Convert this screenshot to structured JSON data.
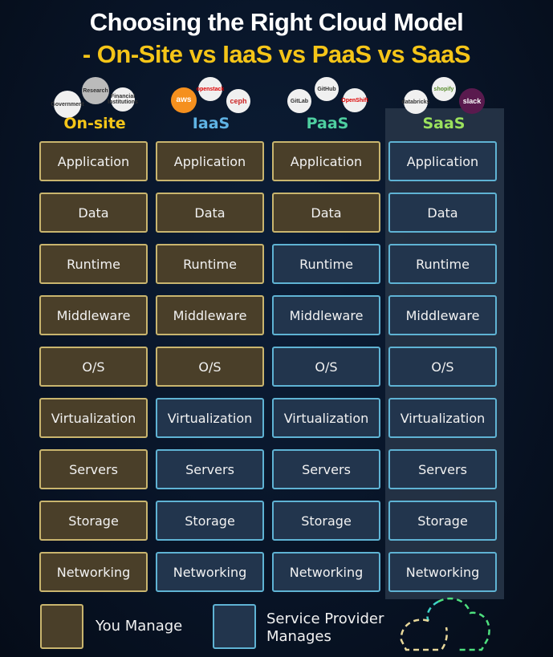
{
  "title": {
    "line1": "Choosing the Right Cloud Model",
    "line2": "- On-Site vs IaaS vs PaaS vs SaaS"
  },
  "columns": [
    {
      "label": "On-site",
      "color": "#f5c518",
      "logos": [
        "Government",
        "Research",
        "Financial Institutions"
      ]
    },
    {
      "label": "IaaS",
      "color": "#5fb3e4",
      "logos": [
        "aws",
        "openstack",
        "ceph"
      ]
    },
    {
      "label": "PaaS",
      "color": "#4ecfa0",
      "logos": [
        "GitLab",
        "GitHub",
        "OpenShift"
      ]
    },
    {
      "label": "SaaS",
      "color": "#9be15d",
      "logos": [
        "databricks",
        "shopify",
        "slack"
      ]
    }
  ],
  "layers": [
    "Application",
    "Data",
    "Runtime",
    "Middleware",
    "O/S",
    "Virtualization",
    "Servers",
    "Storage",
    "Networking"
  ],
  "managed_by": {
    "On-site": [
      "you",
      "you",
      "you",
      "you",
      "you",
      "you",
      "you",
      "you",
      "you"
    ],
    "IaaS": [
      "you",
      "you",
      "you",
      "you",
      "you",
      "provider",
      "provider",
      "provider",
      "provider"
    ],
    "PaaS": [
      "you",
      "you",
      "provider",
      "provider",
      "provider",
      "provider",
      "provider",
      "provider",
      "provider"
    ],
    "SaaS": [
      "provider",
      "provider",
      "provider",
      "provider",
      "provider",
      "provider",
      "provider",
      "provider",
      "provider"
    ]
  },
  "legend": {
    "you": "You Manage",
    "provider_line1": "Service Provider",
    "provider_line2": "Manages"
  },
  "colors": {
    "you_fill": "#4a3f29",
    "you_border": "#c9b56e",
    "provider_fill": "#22354d",
    "provider_border": "#5fb3d4"
  }
}
